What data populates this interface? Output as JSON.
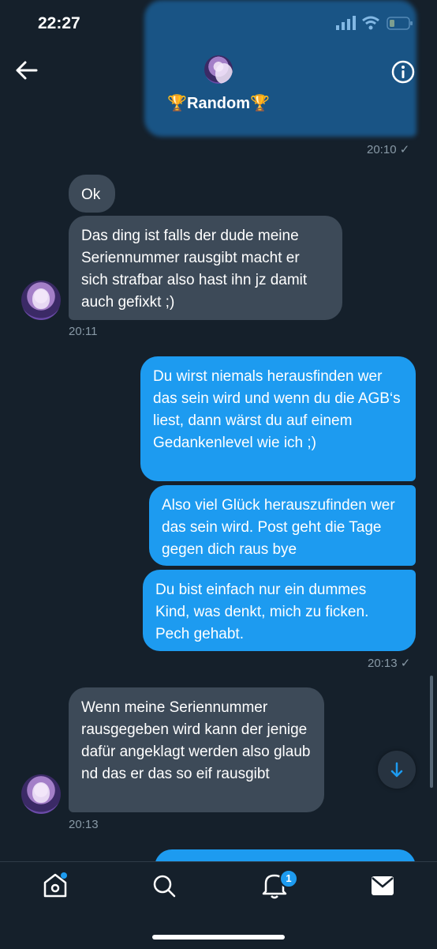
{
  "status_bar": {
    "time": "22:27"
  },
  "header": {
    "title": "🏆Random🏆",
    "back_icon": "arrow-left-icon",
    "info_icon": "info-icon"
  },
  "top_message": {
    "time": "20:10 ✓"
  },
  "messages_in_1": {
    "bubble_1": "Ok",
    "bubble_2": "Das ding ist falls der dude meine Seriennummer rausgibt macht er sich strafbar also hast ihn jz damit auch gefixkt ;)",
    "time": "20:11"
  },
  "messages_out_1": {
    "bubble_1": "Du wirst niemals herausfinden wer das sein wird und wenn du die AGB‘s liest, dann wärst du auf einem Gedankenlevel wie ich ;)",
    "bubble_2": "Also viel Glück herauszufinden wer das sein wird. Post geht die Tage gegen dich raus bye",
    "bubble_3": "Du bist einfach nur ein dummes Kind, was denkt, mich zu ficken. Pech gehabt.",
    "time": "20:13 ✓"
  },
  "messages_in_2": {
    "bubble_1": "Wenn meine Seriennummer rausgegeben wird kann der jenige dafür angeklagt werden also glaub nd das er das so eif rausgibt",
    "time": "20:13"
  },
  "bottom_nav": {
    "notification_count": "1"
  },
  "colors": {
    "background": "#15202b",
    "incoming": "#3d4a58",
    "outgoing": "#1d9bf0",
    "meta": "#8899a6"
  }
}
